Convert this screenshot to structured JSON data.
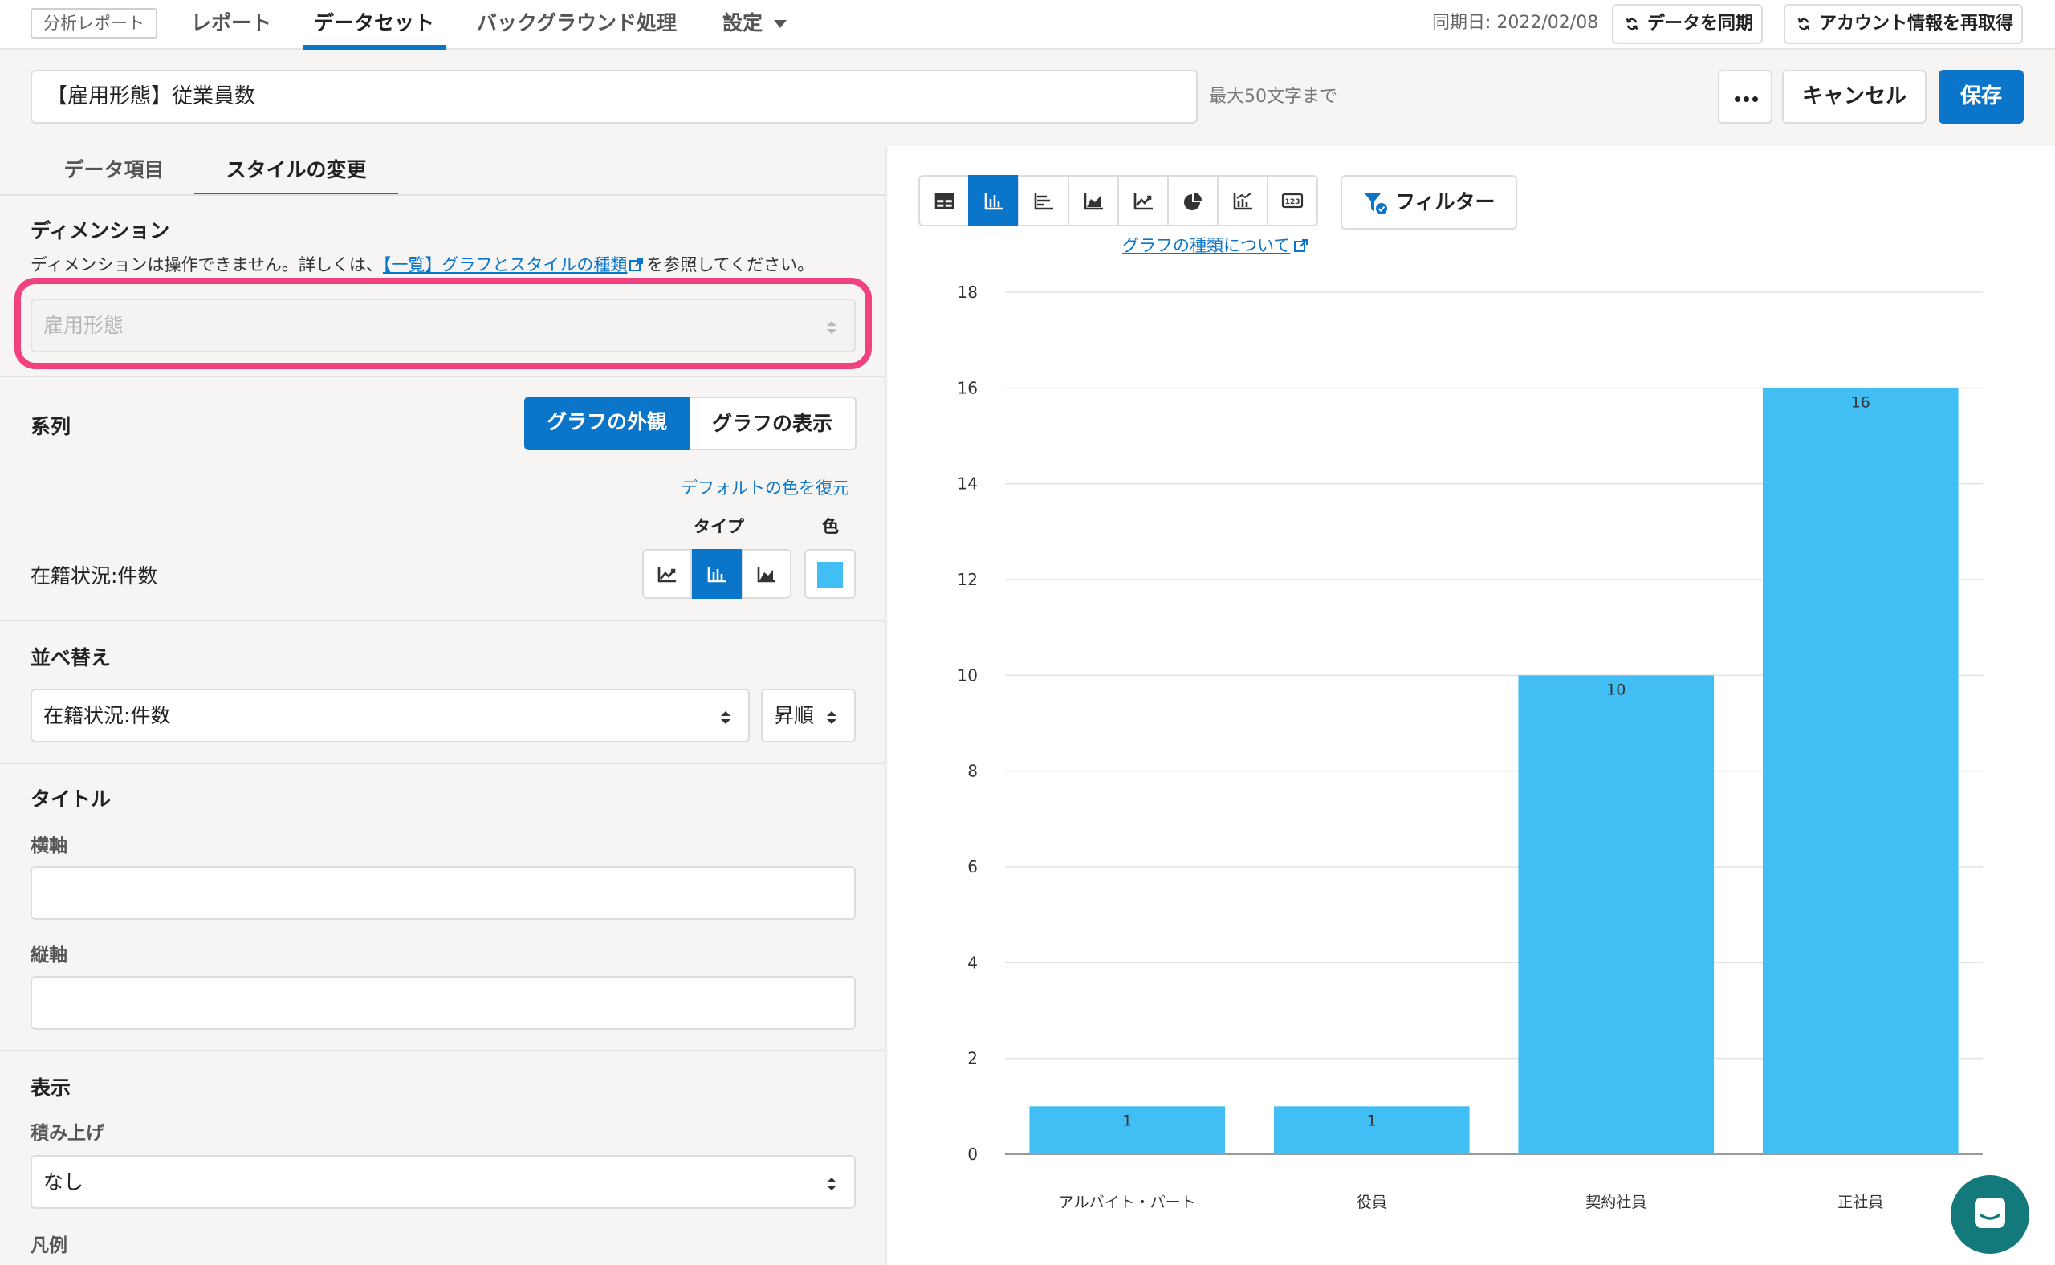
{
  "topnav": {
    "brand": "分析レポート",
    "tabs": [
      "レポート",
      "データセット",
      "バックグラウンド処理",
      "設定"
    ],
    "sync_date": "同期日: 2022/02/08",
    "sync_button": "データを同期",
    "refetch_button": "アカウント情報を再取得"
  },
  "title_bar": {
    "title_value": "【雇用形態】従業員数",
    "char_limit": "最大50文字まで",
    "cancel": "キャンセル",
    "save": "保存"
  },
  "left": {
    "tabs": [
      "データ項目",
      "スタイルの変更"
    ],
    "dimension": {
      "title": "ディメンション",
      "desc_before": "ディメンションは操作できません。詳しくは、",
      "desc_link": "【一覧】グラフとスタイルの種類",
      "desc_after": "を参照してください。",
      "value": "雇用形態"
    },
    "series": {
      "title": "系列",
      "seg_appearance": "グラフの外観",
      "seg_display": "グラフの表示",
      "restore_link": "デフォルトの色を復元",
      "type_label": "タイプ",
      "color_label": "色",
      "row_label": "在籍状況:件数",
      "color": "#41bff5"
    },
    "sort": {
      "title": "並べ替え",
      "field": "在籍状況:件数",
      "order": "昇順"
    },
    "title_section": {
      "title": "タイトル",
      "x_axis": "横軸",
      "y_axis": "縦軸"
    },
    "display": {
      "title": "表示",
      "stack_label": "積み上げ",
      "stack_value": "なし",
      "legend_label": "凡例"
    }
  },
  "right": {
    "chart_type_link": "グラフの種類について",
    "filter_button": "フィルター"
  },
  "chart_data": {
    "type": "bar",
    "categories": [
      "アルバイト・パート",
      "役員",
      "契約社員",
      "正社員"
    ],
    "values": [
      1,
      1,
      10,
      16
    ],
    "ylim": [
      0,
      18
    ],
    "yticks": [
      0,
      2,
      4,
      6,
      8,
      10,
      12,
      14,
      16,
      18
    ],
    "grid": true,
    "bar_color": "#41bff5",
    "data_labels": [
      "1",
      "1",
      "10",
      "16"
    ]
  },
  "colors": {
    "accent": "#0b75c9",
    "highlight": "#f2417f",
    "bar": "#41bff5"
  }
}
